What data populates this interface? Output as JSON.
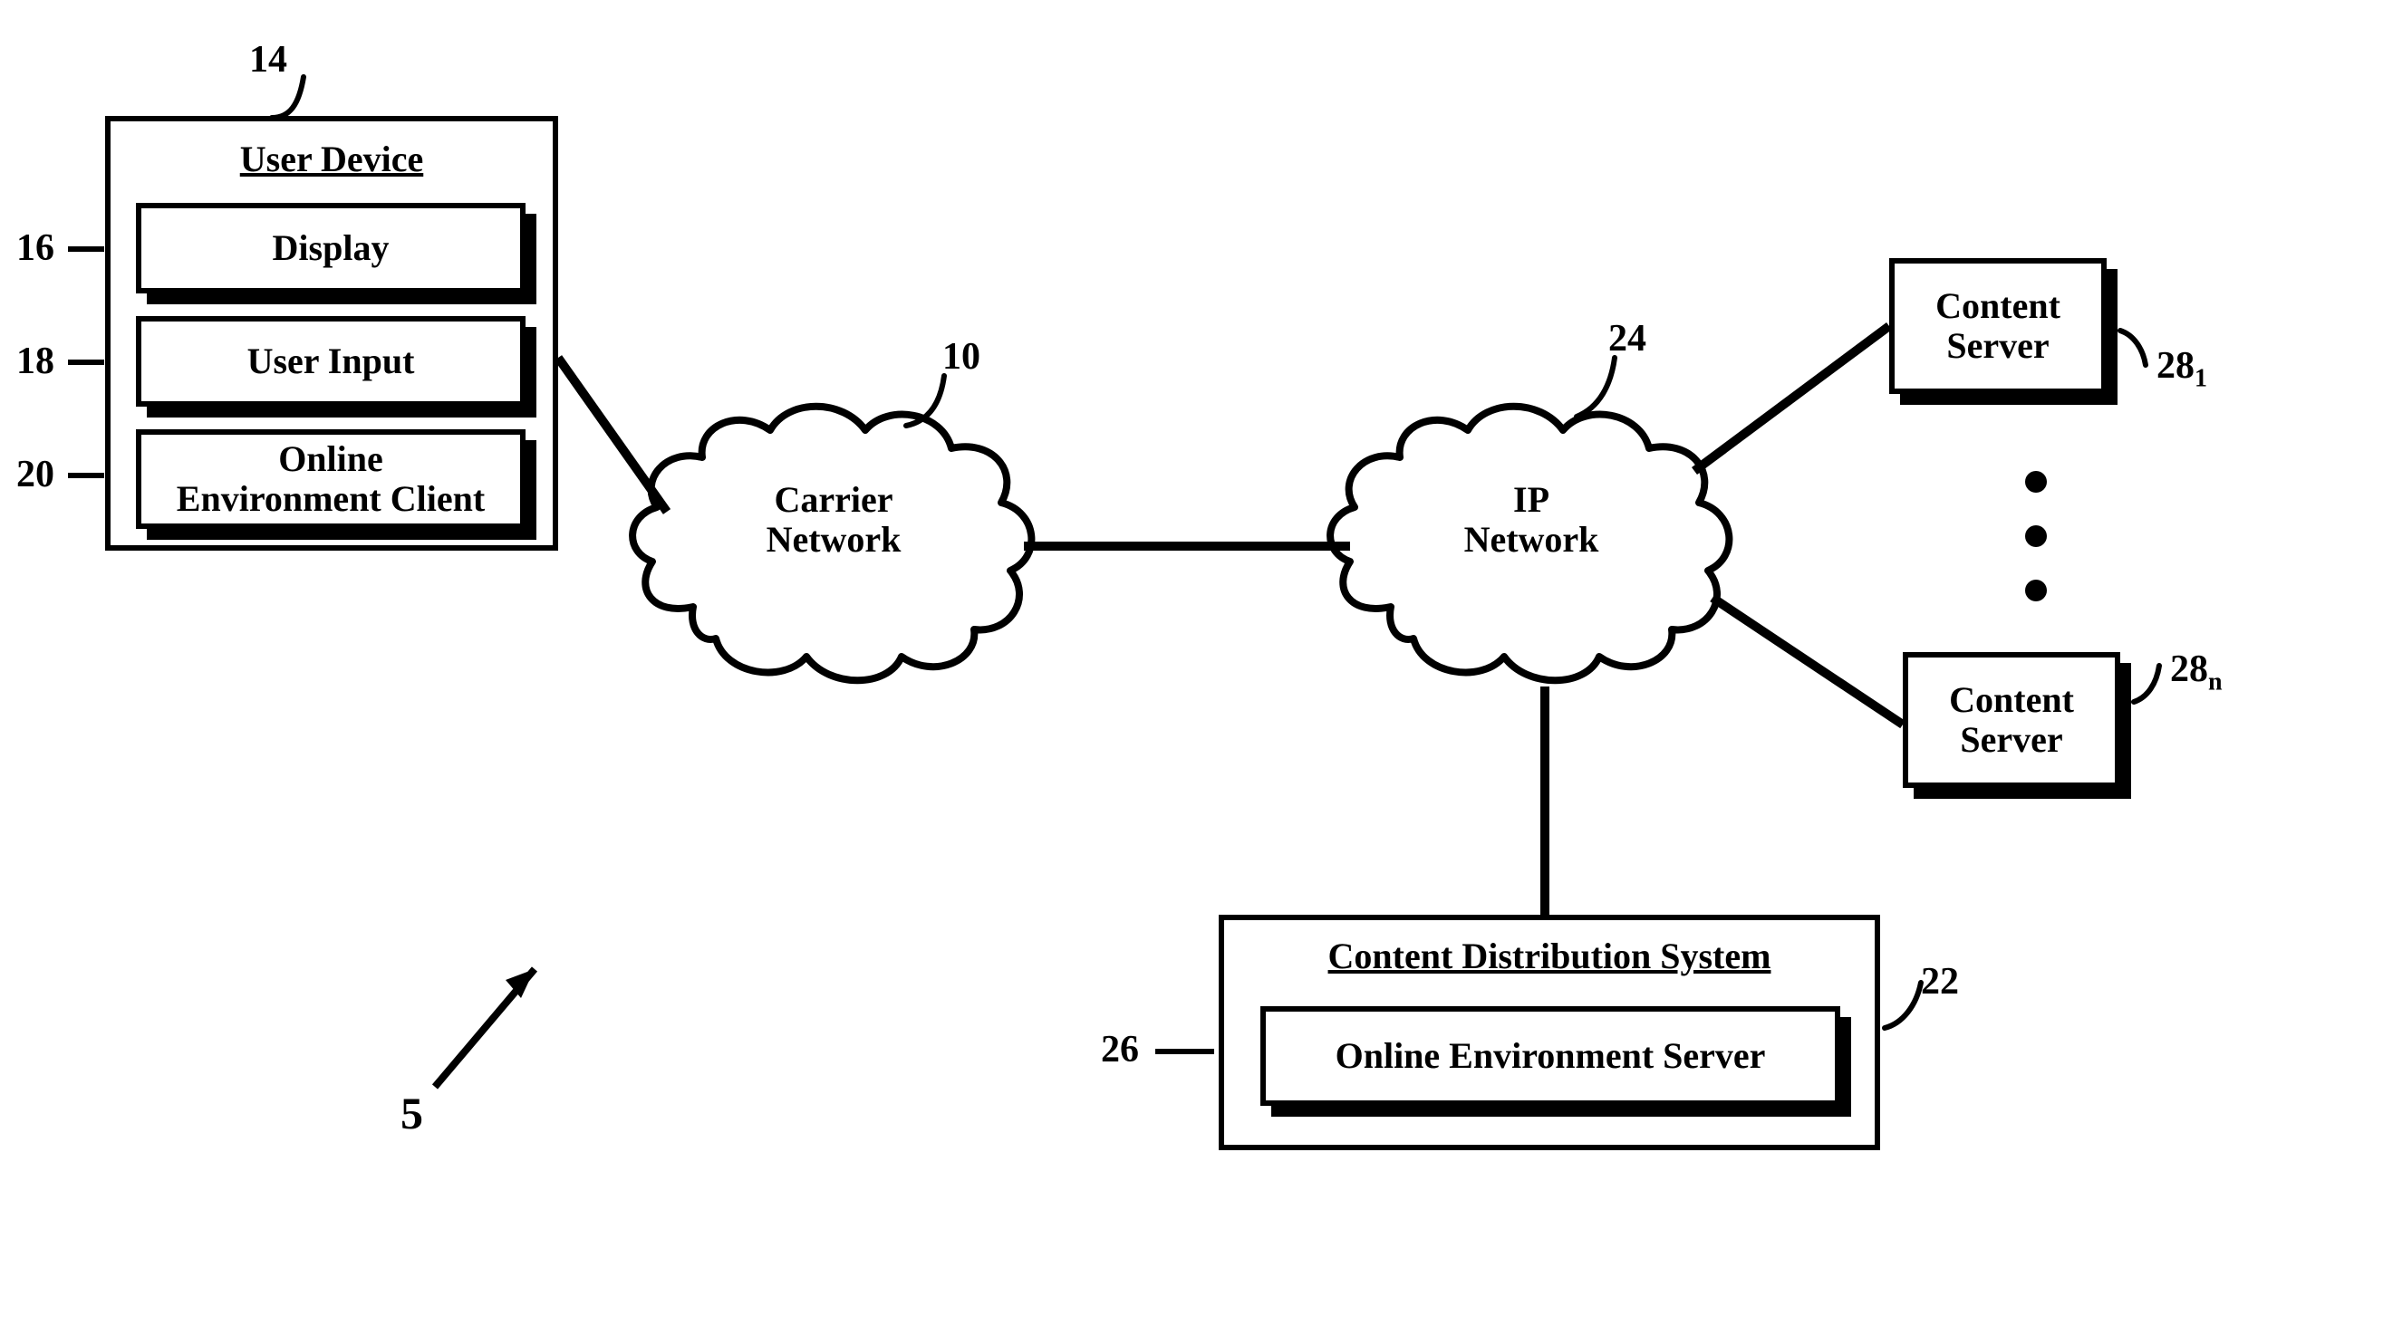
{
  "refs": {
    "fig": "5",
    "user_device": "14",
    "display": "16",
    "user_input": "18",
    "online_env_client": "20",
    "carrier_network": "10",
    "ip_network": "24",
    "cds": "22",
    "online_env_server": "26",
    "content_server_first": "28",
    "content_server_first_sub": "1",
    "content_server_last": "28",
    "content_server_last_sub": "n"
  },
  "labels": {
    "user_device_title": "User Device",
    "display": "Display",
    "user_input": "User Input",
    "online_env_client_l1": "Online",
    "online_env_client_l2": "Environment Client",
    "carrier_l1": "Carrier",
    "carrier_l2": "Network",
    "ip_l1": "IP",
    "ip_l2": "Network",
    "cds_title": "Content Distribution System",
    "online_env_server": "Online Environment Server",
    "content_server_l1": "Content",
    "content_server_l2": "Server"
  }
}
